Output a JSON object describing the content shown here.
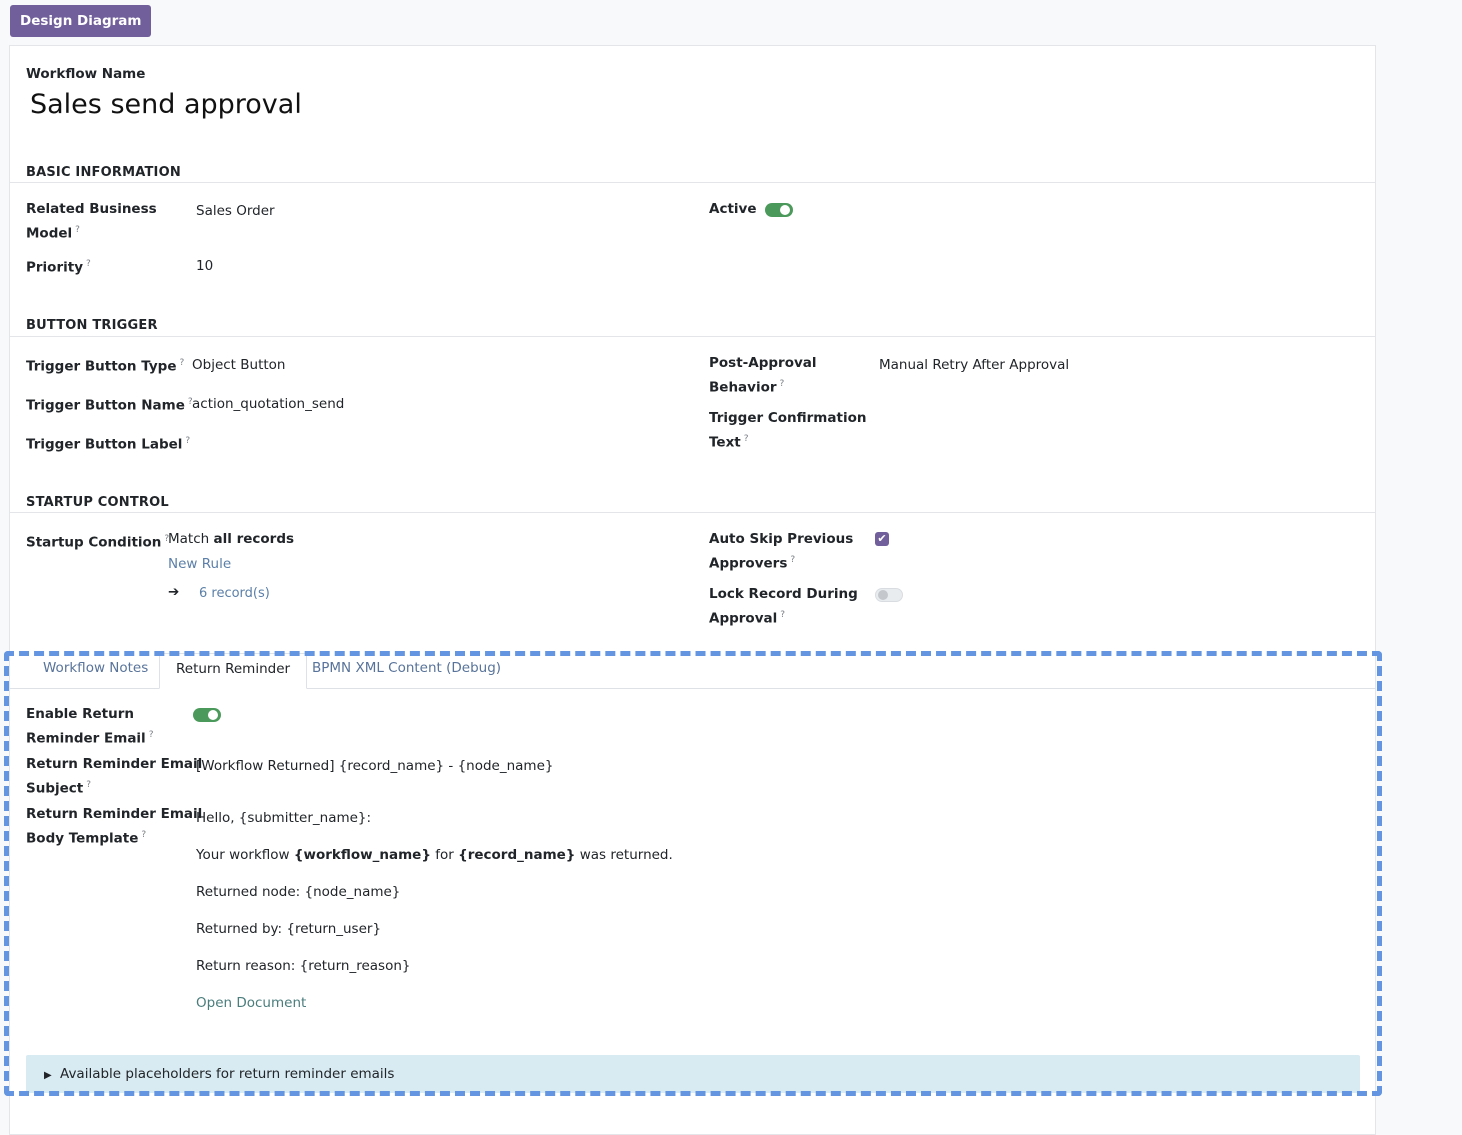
{
  "header": {
    "design_diagram_label": "Design Diagram"
  },
  "form": {
    "workflow_name_label": "Workflow Name",
    "workflow_name": "Sales send approval",
    "basic": {
      "title": "BASIC INFORMATION",
      "related_model_label_1": "Related Business",
      "related_model_label_2": "Model",
      "related_model_value": "Sales Order",
      "priority_label": "Priority",
      "priority_value": "10",
      "active_label": "Active"
    },
    "trigger": {
      "title": "BUTTON TRIGGER",
      "type_label": "Trigger Button Type",
      "type_value": "Object Button",
      "name_label": "Trigger Button Name",
      "name_value": "action_quotation_send",
      "button_label_label": "Trigger Button Label",
      "post_label_1": "Post-Approval",
      "post_label_2": "Behavior",
      "post_value": "Manual Retry After Approval",
      "confirm_label_1": "Trigger Confirmation",
      "confirm_label_2": "Text"
    },
    "startup": {
      "title": "STARTUP CONTROL",
      "condition_label": "Startup Condition",
      "match_prefix": "Match",
      "match_bold": "all records",
      "new_rule": "New Rule",
      "records": "6 record(s)",
      "auto_skip_label_1": "Auto Skip Previous",
      "auto_skip_label_2": "Approvers",
      "lock_label_1": "Lock Record During",
      "lock_label_2": "Approval"
    },
    "tabs": [
      "Workflow Notes",
      "Return Reminder",
      "BPMN XML Content (Debug)"
    ],
    "reminder": {
      "enable_label_1": "Enable Return",
      "enable_label_2": "Reminder Email",
      "subject_label_1": "Return Reminder Email",
      "subject_label_2": "Subject",
      "subject_value": "[Workflow Returned] {record_name} - {node_name}",
      "body_label_1": "Return Reminder Email",
      "body_label_2": "Body Template",
      "body_greeting": "Hello, {submitter_name}:",
      "body_line2_a": "Your workflow ",
      "body_line2_b": "{workflow_name}",
      "body_line2_c": " for ",
      "body_line2_d": "{record_name}",
      "body_line2_e": " was returned.",
      "body_node": "Returned node: {node_name}",
      "body_by": "Returned by: {return_user}",
      "body_reason": "Return reason: {return_reason}",
      "body_link": "Open Document",
      "placeholders": "Available placeholders for return reminder emails"
    }
  }
}
